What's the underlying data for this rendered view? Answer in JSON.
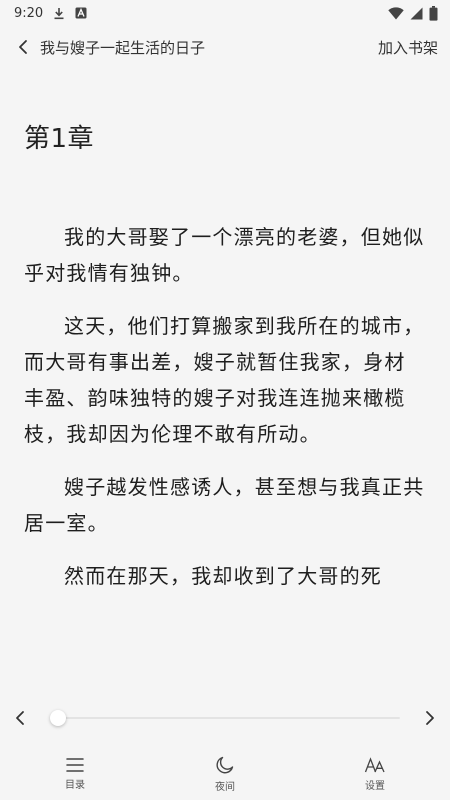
{
  "status_bar": {
    "time": "9:20",
    "icons": [
      "download-icon",
      "font-a-icon",
      "wifi-icon",
      "signal-icon",
      "battery-icon"
    ]
  },
  "header": {
    "book_title": "我与嫂子一起生活的日子",
    "add_to_shelf": "加入书架"
  },
  "chapter": {
    "title": "第1章",
    "paragraphs": [
      "我的大哥娶了一个漂亮的老婆，但她似乎对我情有独钟。",
      "这天，他们打算搬家到我所在的城市，而大哥有事出差，嫂子就暂住我家，身材丰盈、韵味独特的嫂子对我连连抛来橄榄枝，我却因为伦理不敢有所动。",
      "嫂子越发性感诱人，甚至想与我真正共居一室。",
      "然而在那天，我却收到了大哥的死"
    ]
  },
  "progress": {
    "value": 0.0
  },
  "toolbar": {
    "catalog": "目录",
    "night": "夜间",
    "settings": "设置"
  },
  "colors": {
    "background": "#f5f5f5",
    "text": "#1e1e1e"
  }
}
